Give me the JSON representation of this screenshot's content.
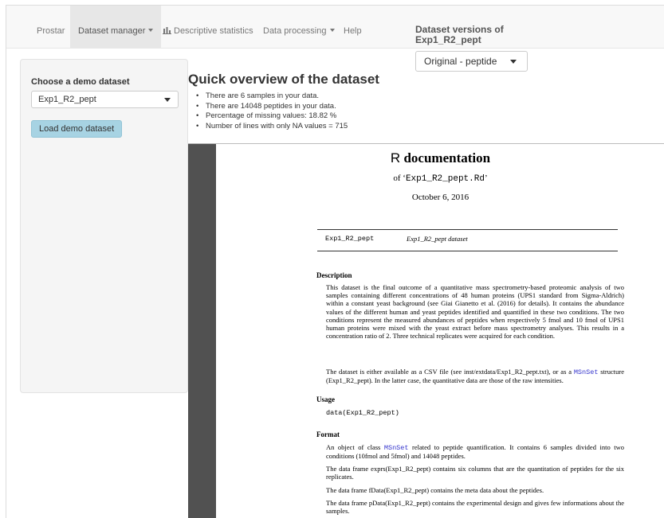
{
  "navbar": {
    "items": [
      {
        "label": "Prostar",
        "active": false,
        "dropdown": false
      },
      {
        "label": "Dataset manager",
        "active": true,
        "dropdown": true
      },
      {
        "label": "Descriptive statistics",
        "active": false,
        "dropdown": false,
        "icon": "bar-chart-icon"
      },
      {
        "label": "Data processing",
        "active": false,
        "dropdown": true
      },
      {
        "label": "Help",
        "active": false,
        "dropdown": false
      }
    ],
    "versions_title_line1": "Dataset versions of",
    "versions_title_line2": "Exp1_R2_pept",
    "version_selected": "Original - peptide"
  },
  "sidebar": {
    "label": "Choose a demo dataset",
    "selected_dataset": "Exp1_R2_pept",
    "load_button": "Load demo dataset"
  },
  "main": {
    "title": "Quick overview of the dataset",
    "stats": [
      "There are 6 samples in your data.",
      "There are 14048 peptides in your data.",
      "Percentage of missing values: 18.82 %",
      "Number of lines with only NA values = 715"
    ]
  },
  "doc": {
    "title_r": "R",
    "title_rest": "documentation",
    "subtitle_pre": "of ‘",
    "subtitle_file": "Exp1_R2_pept.Rd",
    "subtitle_post": "’",
    "date": "October 6, 2016",
    "header_name": "Exp1_R2_pept",
    "header_desc": "Exp1_R2_pept dataset",
    "description_heading": "Description",
    "description_p1": "This dataset is the final outcome of a quantitative mass spectrometry-based proteomic analysis of two samples containing different concentrations of 48 human proteins (UPS1 standard from Sigma-Aldrich) within a constant yeast background (see Giai Gianetto et al. (2016) for details). It contains the abundance values of the different human and yeast peptides identified and quantified in these two conditions. The two conditions represent the measured abundances of peptides when respectively 5 fmol and 10 fmol of UPS1 human proteins were mixed with the yeast extract before mass spectrometry analyses. This results in a concentration ratio of 2. Three technical replicates were acquired for each condition.",
    "description_p2_a": "The dataset is either available as a CSV file (see inst/extdata/Exp1_R2_pept.txt), or as a ",
    "description_p2_link": "MSnSet",
    "description_p2_b": " structure (Exp1_R2_pept). In the latter case, the quantitative data are those of the raw intensities.",
    "usage_heading": "Usage",
    "usage_code": "data(Exp1_R2_pept)",
    "format_heading": "Format",
    "format_p1_a": "An object of class ",
    "format_p1_link": "MSnSet",
    "format_p1_b": " related to peptide quantification. It contains 6 samples divided into two conditions (10fmol and 5fmol) and 14048 peptides.",
    "format_p2": "The data frame exprs(Exp1_R2_pept) contains six columns that are the quantitation of peptides for the six replicates.",
    "format_p3": "The data frame fData(Exp1_R2_pept) contains the meta data about the peptides.",
    "format_p4": "The data frame pData(Exp1_R2_pept) contains the experimental design and gives few informations about the samples."
  },
  "colors": {
    "navbar_bg": "#f8f8f8",
    "active_tab_bg": "#e7e7e7",
    "button_bg": "#a7d3e3",
    "doc_gutter": "#515151",
    "link_blue": "#3333cc"
  }
}
